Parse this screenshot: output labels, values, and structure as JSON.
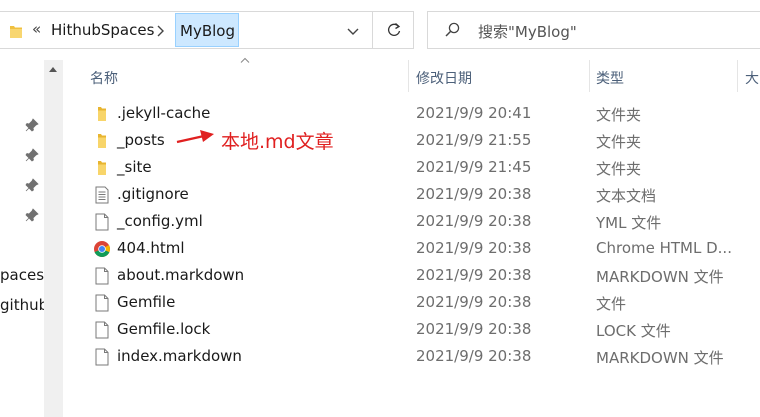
{
  "address_bar": {
    "overflow_chevron": "«",
    "crumbs": [
      "HithubSpaces",
      "MyBlog"
    ]
  },
  "search": {
    "placeholder": "搜索\"MyBlog\""
  },
  "nav_pane": {
    "items": [
      "paces",
      "github"
    ]
  },
  "columns": {
    "name": "名称",
    "modified": "修改日期",
    "type": "类型",
    "size": "大"
  },
  "files": [
    {
      "name": ".jekyll-cache",
      "modified": "2021/9/9 20:41",
      "type": "文件夹",
      "icon": "folder-icon"
    },
    {
      "name": "_posts",
      "modified": "2021/9/9 21:55",
      "type": "文件夹",
      "icon": "folder-icon"
    },
    {
      "name": "_site",
      "modified": "2021/9/9 21:45",
      "type": "文件夹",
      "icon": "folder-icon"
    },
    {
      "name": ".gitignore",
      "modified": "2021/9/9 20:38",
      "type": "文本文档",
      "icon": "text-document-icon"
    },
    {
      "name": "_config.yml",
      "modified": "2021/9/9 20:38",
      "type": "YML 文件",
      "icon": "file-icon"
    },
    {
      "name": "404.html",
      "modified": "2021/9/9 20:38",
      "type": "Chrome HTML D...",
      "icon": "chrome-icon"
    },
    {
      "name": "about.markdown",
      "modified": "2021/9/9 20:38",
      "type": "MARKDOWN 文件",
      "icon": "file-icon"
    },
    {
      "name": "Gemfile",
      "modified": "2021/9/9 20:38",
      "type": "文件",
      "icon": "file-icon"
    },
    {
      "name": "Gemfile.lock",
      "modified": "2021/9/9 20:38",
      "type": "LOCK 文件",
      "icon": "file-icon"
    },
    {
      "name": "index.markdown",
      "modified": "2021/9/9 20:38",
      "type": "MARKDOWN 文件",
      "icon": "file-icon"
    }
  ],
  "annotation": {
    "text": "本地.md文章",
    "color": "#e02020"
  },
  "colors": {
    "folder": "#f0c040",
    "selection_bg": "#cde8ff",
    "header_text": "#4c607a"
  }
}
